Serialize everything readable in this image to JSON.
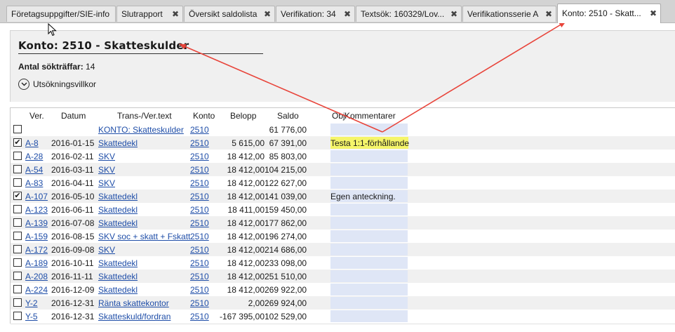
{
  "tabs": [
    {
      "label": "Företagsuppgifter/SIE-info",
      "closable": false
    },
    {
      "label": "Slutrapport",
      "closable": true
    },
    {
      "label": "Översikt saldolista",
      "closable": true
    },
    {
      "label": "Verifikation: 34",
      "closable": true
    },
    {
      "label": "Textsök: 160329/Lov...",
      "closable": true
    },
    {
      "label": "Verifikationsserie A",
      "closable": true
    },
    {
      "label": "Konto: 2510 - Skatt...",
      "closable": true,
      "active": true
    }
  ],
  "close_glyph": "✖",
  "header": {
    "title": "Konto: 2510 - Skatteskulder",
    "hits_label": "Antal sökträffar:",
    "hits_value": "14",
    "filter_label": "Utsökningsvillkor"
  },
  "columns": [
    "Ver.",
    "Datum",
    "Trans-/Ver.text",
    "Konto",
    "Belopp",
    "Saldo",
    "Obj",
    "Kommentarer"
  ],
  "rows": [
    {
      "checked": false,
      "ver": "",
      "date": "",
      "text": "KONTO: Skatteskulder",
      "konto": "2510",
      "belopp": "",
      "saldo": "61 776,00",
      "comment": ""
    },
    {
      "checked": true,
      "ver": "A-8",
      "date": "2016-01-15",
      "text": "Skattedekl",
      "konto": "2510",
      "belopp": "5 615,00",
      "saldo": "67 391,00",
      "comment": "Testa 1:1-förhållande",
      "highlight": true
    },
    {
      "checked": false,
      "ver": "A-28",
      "date": "2016-02-11",
      "text": "SKV",
      "konto": "2510",
      "belopp": "18 412,00",
      "saldo": "85 803,00",
      "comment": ""
    },
    {
      "checked": false,
      "ver": "A-54",
      "date": "2016-03-11",
      "text": "SKV",
      "konto": "2510",
      "belopp": "18 412,00",
      "saldo": "104 215,00",
      "comment": ""
    },
    {
      "checked": false,
      "ver": "A-83",
      "date": "2016-04-11",
      "text": "SKV",
      "konto": "2510",
      "belopp": "18 412,00",
      "saldo": "122 627,00",
      "comment": ""
    },
    {
      "checked": true,
      "ver": "A-107",
      "date": "2016-05-10",
      "text": "Skattedekl",
      "konto": "2510",
      "belopp": "18 412,00",
      "saldo": "141 039,00",
      "comment": "Egen anteckning."
    },
    {
      "checked": false,
      "ver": "A-123",
      "date": "2016-06-11",
      "text": "Skattedekl",
      "konto": "2510",
      "belopp": "18 411,00",
      "saldo": "159 450,00",
      "comment": ""
    },
    {
      "checked": false,
      "ver": "A-139",
      "date": "2016-07-08",
      "text": "Skattedekl",
      "konto": "2510",
      "belopp": "18 412,00",
      "saldo": "177 862,00",
      "comment": ""
    },
    {
      "checked": false,
      "ver": "A-159",
      "date": "2016-08-15",
      "text": "SKV soc + skatt + Fskatt",
      "konto": "2510",
      "belopp": "18 412,00",
      "saldo": "196 274,00",
      "comment": ""
    },
    {
      "checked": false,
      "ver": "A-172",
      "date": "2016-09-08",
      "text": "SKV",
      "konto": "2510",
      "belopp": "18 412,00",
      "saldo": "214 686,00",
      "comment": ""
    },
    {
      "checked": false,
      "ver": "A-189",
      "date": "2016-10-11",
      "text": "Skattedekl",
      "konto": "2510",
      "belopp": "18 412,00",
      "saldo": "233 098,00",
      "comment": ""
    },
    {
      "checked": false,
      "ver": "A-208",
      "date": "2016-11-11",
      "text": "Skattedekl",
      "konto": "2510",
      "belopp": "18 412,00",
      "saldo": "251 510,00",
      "comment": ""
    },
    {
      "checked": false,
      "ver": "A-224",
      "date": "2016-12-09",
      "text": "Skattedekl",
      "konto": "2510",
      "belopp": "18 412,00",
      "saldo": "269 922,00",
      "comment": ""
    },
    {
      "checked": false,
      "ver": "Y-2",
      "date": "2016-12-31",
      "text": "Ränta skattekontor",
      "konto": "2510",
      "belopp": "2,00",
      "saldo": "269 924,00",
      "comment": ""
    },
    {
      "checked": false,
      "ver": "Y-5",
      "date": "2016-12-31",
      "text": "Skatteskuld/fordran",
      "konto": "2510",
      "belopp": "-167 395,00",
      "saldo": "102 529,00",
      "comment": ""
    }
  ],
  "colors": {
    "link": "#1f4ea8",
    "highlight": "#f5f56a",
    "comment_bg": "#dfe6f6",
    "arrow": "#e8443a"
  }
}
